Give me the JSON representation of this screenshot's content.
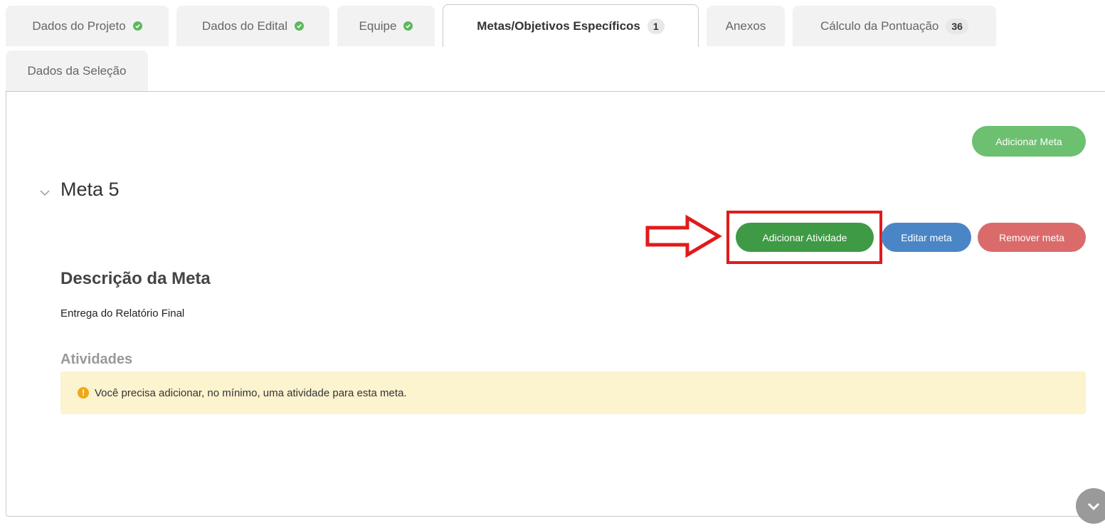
{
  "tabs": [
    {
      "label": "Dados do Projeto",
      "complete": true
    },
    {
      "label": "Dados do Edital",
      "complete": true
    },
    {
      "label": "Equipe",
      "complete": true
    },
    {
      "label": "Metas/Objetivos Específicos",
      "badge": "1",
      "active": true
    },
    {
      "label": "Anexos"
    },
    {
      "label": "Cálculo da Pontuação",
      "badge": "36"
    },
    {
      "label": "Dados da Seleção"
    }
  ],
  "actions": {
    "add_meta": "Adicionar Meta",
    "add_atividade": "Adicionar Atividade",
    "edit_meta": "Editar meta",
    "remove_meta": "Remover meta"
  },
  "meta": {
    "title": "Meta 5",
    "description_heading": "Descrição da Meta",
    "description": "Entrega do Relatório Final",
    "activities_heading": "Atividades",
    "warning": "Você precisa adicionar, no mínimo, uma atividade para esta meta."
  },
  "colors": {
    "success": "#5cb85c",
    "primary_green": "#3e9a44",
    "blue": "#4a86c6",
    "danger": "#db6b6b",
    "highlight": "#e01b1b",
    "warning_bg": "#fcf3cf"
  }
}
